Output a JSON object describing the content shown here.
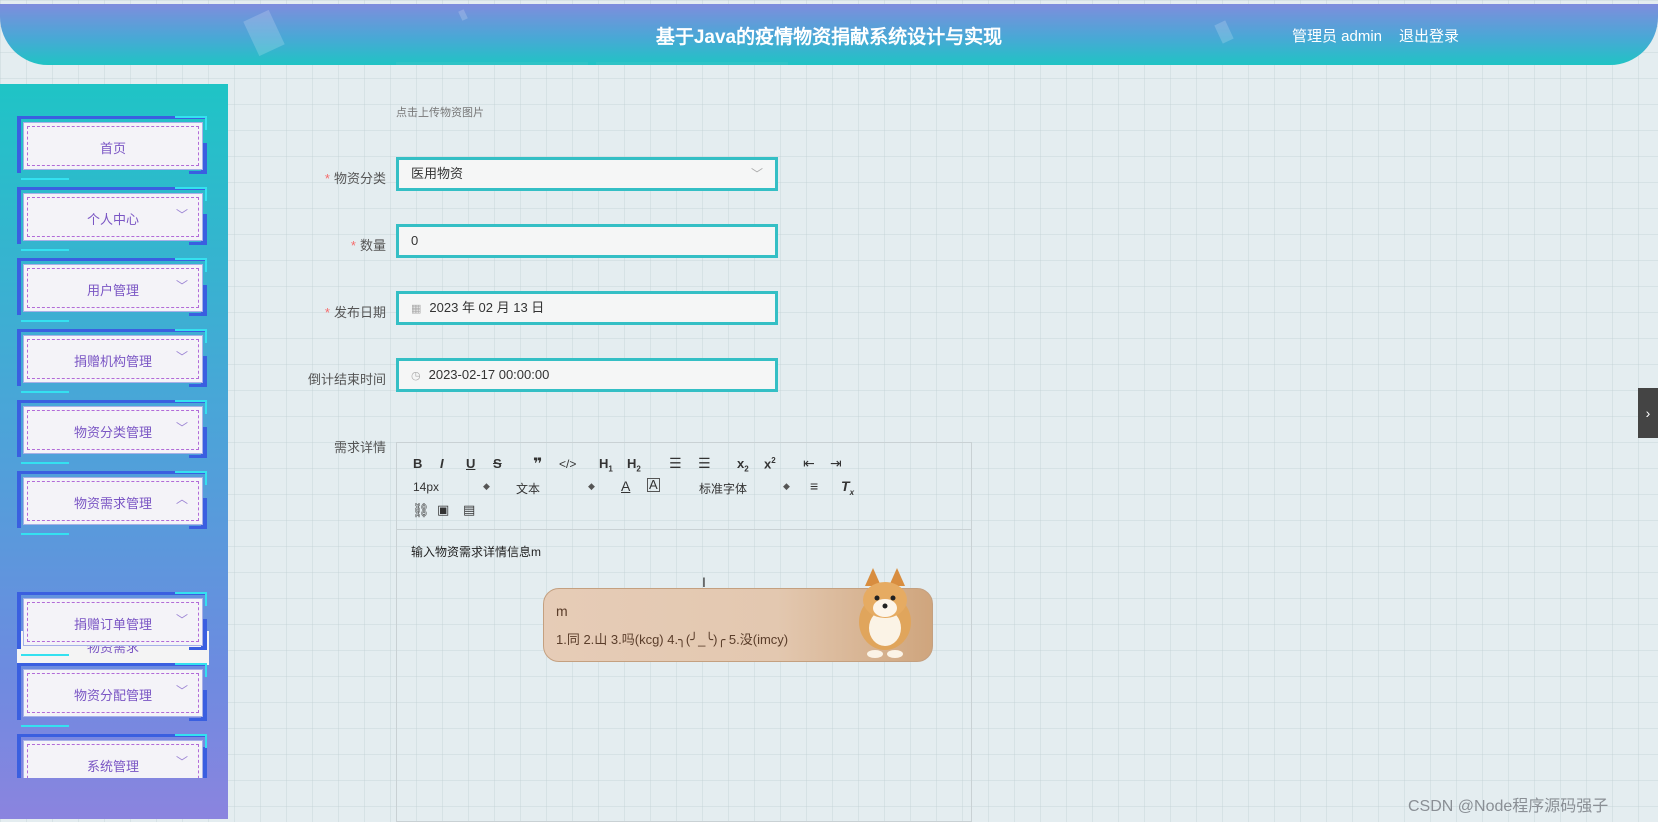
{
  "header": {
    "title": "基于Java的疫情物资捐献系统设计与实现",
    "user_label": "管理员 admin",
    "logout_label": "退出登录"
  },
  "sidebar": {
    "items": [
      {
        "label": "首页",
        "expandable": false
      },
      {
        "label": "个人中心",
        "expandable": true
      },
      {
        "label": "用户管理",
        "expandable": true
      },
      {
        "label": "捐赠机构管理",
        "expandable": true
      },
      {
        "label": "物资分类管理",
        "expandable": true
      },
      {
        "label": "物资需求管理",
        "expandable": true,
        "expanded": true
      },
      {
        "label": "捐赠订单管理",
        "expandable": true
      },
      {
        "label": "物资分配管理",
        "expandable": true
      },
      {
        "label": "系统管理",
        "expandable": true
      }
    ],
    "submenu_item": "物资需求",
    "chevron_down": "﹀",
    "chevron_up": "︿"
  },
  "form": {
    "upload_hint": "点击上传物资图片",
    "category": {
      "label": "物资分类",
      "value": "医用物资",
      "required": true
    },
    "quantity": {
      "label": "数量",
      "value": "0",
      "required": true
    },
    "publish_date": {
      "label": "发布日期",
      "value": "2023 年 02 月 13 日",
      "required": true
    },
    "countdown_end": {
      "label": "倒计结束时间",
      "value": "2023-02-17 00:00:00",
      "required": false
    },
    "details": {
      "label": "需求详情"
    }
  },
  "editor": {
    "font_size": "14px",
    "block_type": "文本",
    "font_family": "标准字体",
    "content": "输入物资需求详情信息m"
  },
  "ime": {
    "input": "m",
    "candidates": "1.同  2.山  3.吗(kcg)  4.╮(╯_╰)╭  5.没(imcy)"
  },
  "watermark": "CSDN @Node程序源码强子",
  "colors": {
    "accent": "#34bfc5",
    "sidebar_frame": "#3a5fe0",
    "menu_text": "#7a55c4",
    "required": "#f56c6c"
  }
}
